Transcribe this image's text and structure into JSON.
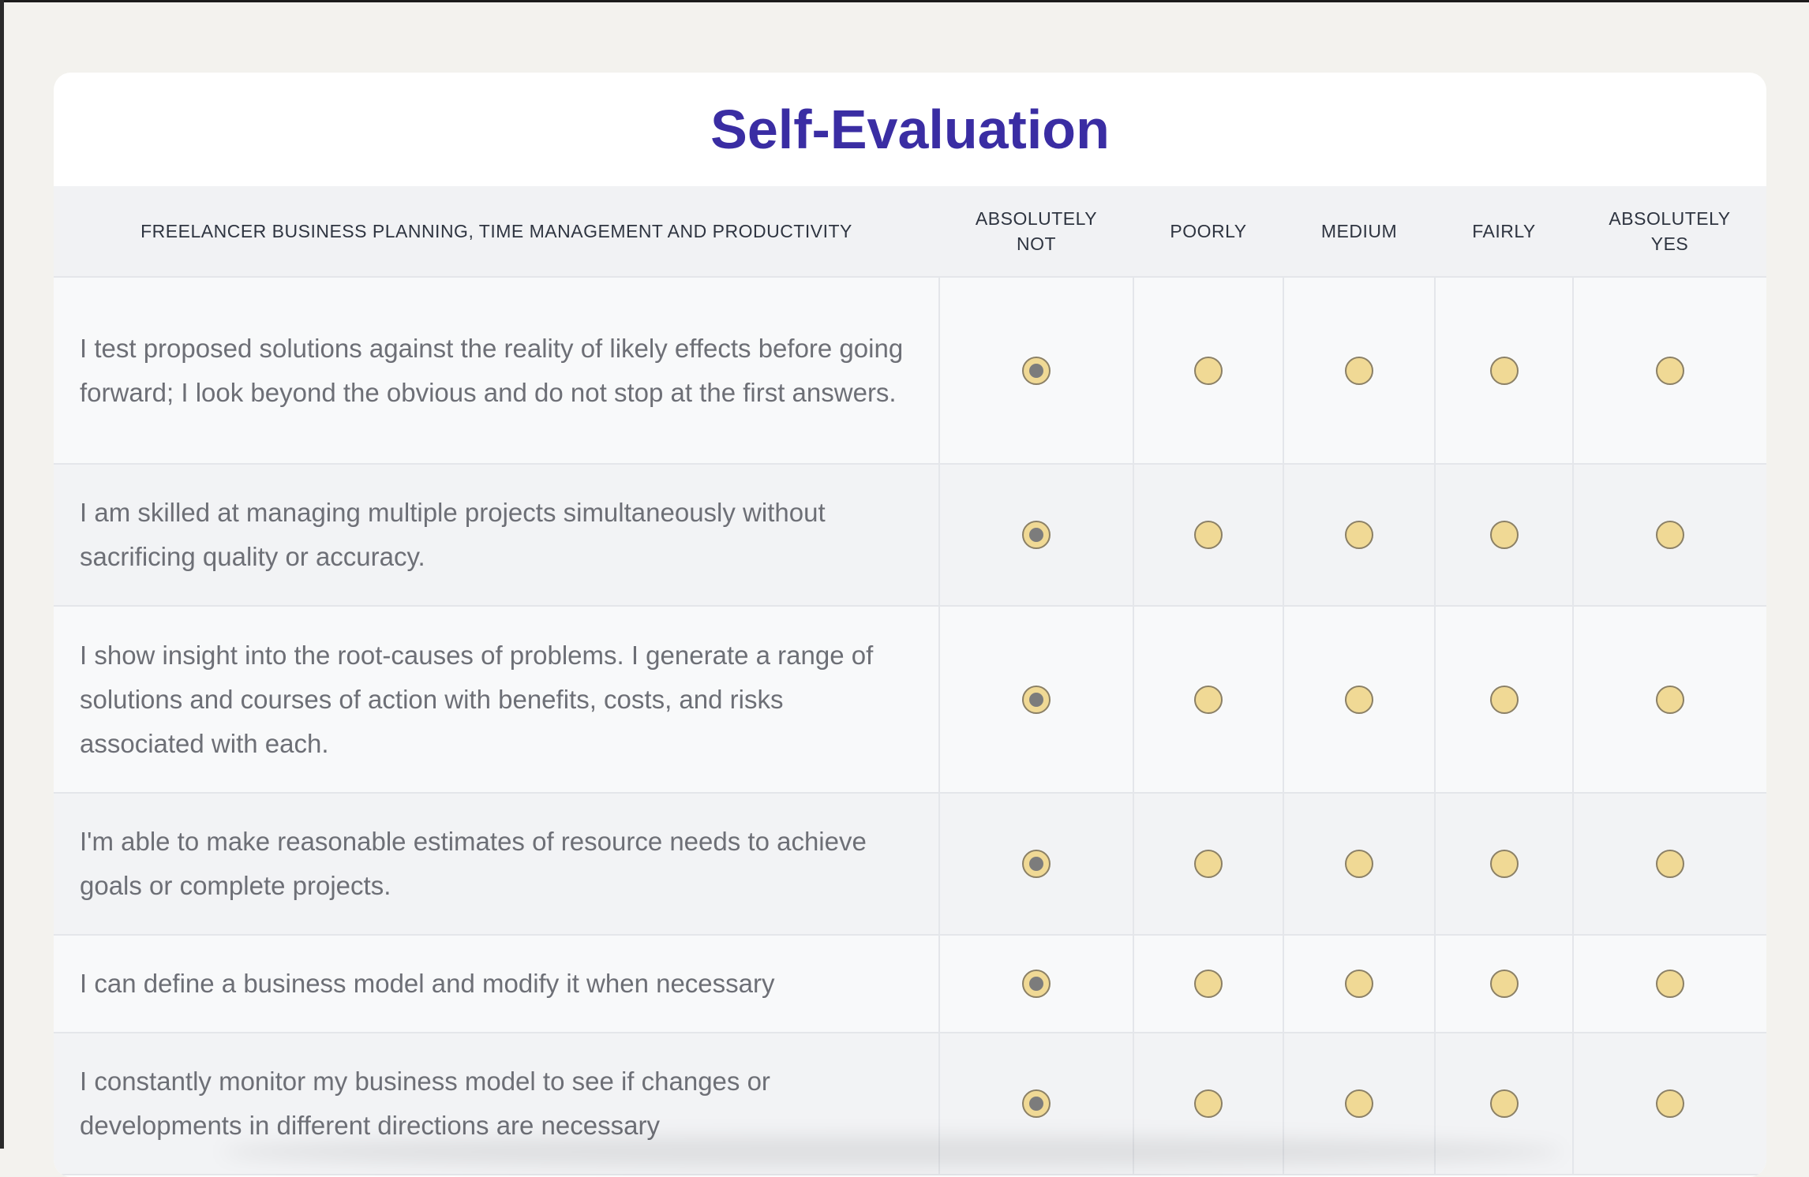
{
  "title": "Self-Evaluation",
  "columns": {
    "category": "FREELANCER BUSINESS PLANNING, TIME MANAGEMENT AND PRODUCTIVITY",
    "absolutely_not_line1": "ABSOLUTELY",
    "absolutely_not_line2": "NOT",
    "poorly": "POORLY",
    "medium": "MEDIUM",
    "fairly": "FAIRLY",
    "absolutely_yes_line1": "ABSOLUTELY",
    "absolutely_yes_line2": "YES"
  },
  "rows": [
    {
      "statement": "I test proposed solutions against the reality of likely effects before going forward; I look beyond the obvious and do not stop at the first answers.",
      "selected": "absolutely_not"
    },
    {
      "statement": "I am skilled at managing multiple projects simultaneously without sacrificing quality or accuracy.",
      "selected": "absolutely_not"
    },
    {
      "statement": "I show insight into the root-causes of problems. I generate a range of solutions and courses of action with benefits, costs, and risks associated with each.",
      "selected": "absolutely_not"
    },
    {
      "statement": "I'm able to make reasonable estimates of resource needs to achieve goals or complete projects.",
      "selected": "absolutely_not"
    },
    {
      "statement": "I can define a business model and modify it when necessary",
      "selected": "absolutely_not"
    },
    {
      "statement": "I constantly monitor my business model to see if changes or developments in different directions are necessary",
      "selected": "absolutely_not"
    }
  ],
  "colors": {
    "title": "#3a2da3",
    "radio_fill": "#f0d995",
    "radio_selected_dot": "#7c7c7c",
    "background": "#f3f2ee"
  }
}
